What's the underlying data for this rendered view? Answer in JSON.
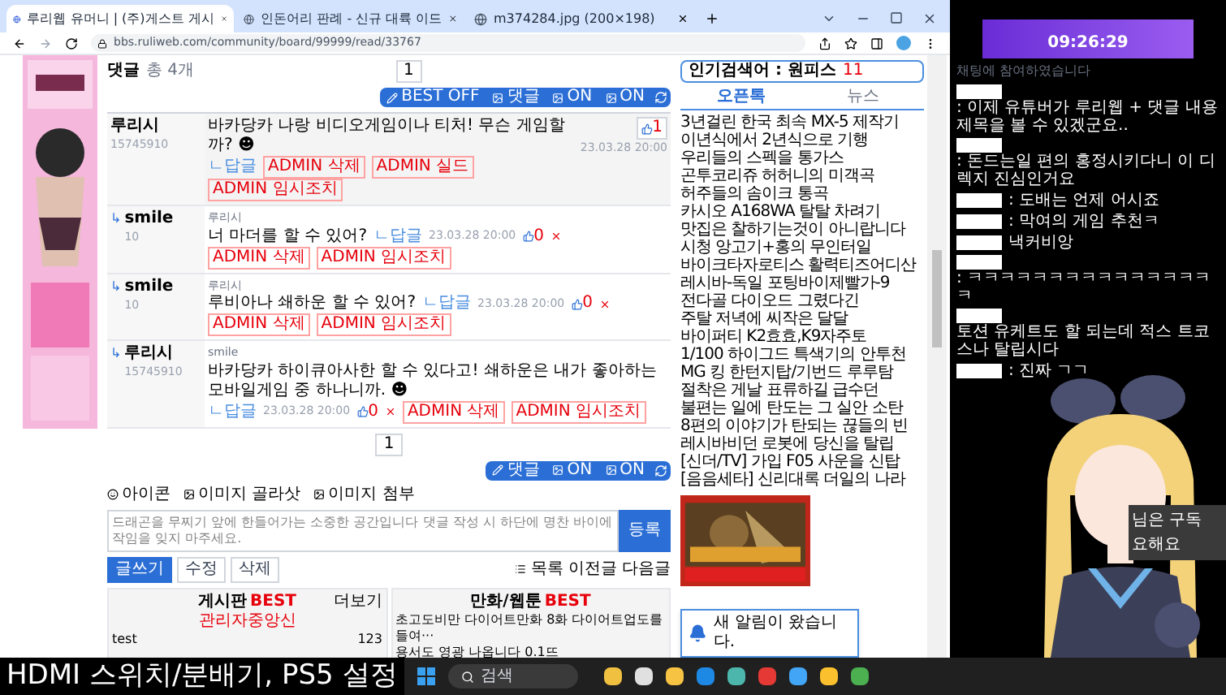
{
  "browser": {
    "tabs": [
      {
        "title": "루리웹 유머니 | (주)게스트 게시",
        "selected": true
      },
      {
        "title": "인돈어리 판례 - 신규 대륙 이드",
        "selected": false
      },
      {
        "title": "m374284.jpg (200×198)",
        "selected": false
      }
    ],
    "address": "bbs.ruliweb.com/community/board/99999/read/33767"
  },
  "comments": {
    "title": "댓글",
    "count": "총 4개",
    "page": "1",
    "bottom_page": "1",
    "toolbar_top": [
      "BEST OFF",
      "댓글",
      "ON",
      "ON"
    ],
    "toolbar_bottom": [
      "댓글",
      "ON",
      "ON"
    ],
    "items": [
      {
        "kind": "top",
        "author": "루리시",
        "user_id": "15745910",
        "text": "바카당카 나랑 비디오게임이나 티처! 무슨 게임할까? ☻",
        "reply_link": "ㄴ답글",
        "date": "23.03.28 20:00",
        "likes": "1",
        "admin": [
          "ADMIN 삭제",
          "ADMIN 실드",
          "ADMIN 임시조치"
        ]
      },
      {
        "kind": "reply",
        "reply_mark": "↳",
        "author": "smile",
        "user_id": "10",
        "quote": "루리시",
        "text": "너 마더를 할 수 있어?",
        "reply_link": "ㄴ답글",
        "date": "23.03.28 20:00",
        "likes": "0",
        "admin": [
          "ADMIN 삭제",
          "ADMIN 임시조치"
        ]
      },
      {
        "kind": "reply",
        "reply_mark": "↳",
        "author": "smile",
        "user_id": "10",
        "quote": "루리시",
        "text": "루비아나 쇄하운 할 수 있어?",
        "reply_link": "ㄴ답글",
        "date": "23.03.28 20:00",
        "likes": "0",
        "admin": [
          "ADMIN 삭제",
          "ADMIN 임시조치"
        ]
      },
      {
        "kind": "reply",
        "reply_mark": "↳",
        "author": "루리시",
        "user_id": "15745910",
        "quote": "smile",
        "text": "바카당카 하이큐아사한 할 수 있다고! 쇄하운은 내가 좋아하는 모바일게임 중 하나니까. ☻",
        "reply_link": "ㄴ답글",
        "date": "23.03.28 20:00",
        "likes": "0",
        "admin": [
          "ADMIN 삭제",
          "ADMIN 임시조치"
        ]
      }
    ]
  },
  "editor": {
    "tools": [
      "아이콘",
      "이미지 골라삿",
      "이미지 첨부"
    ],
    "placeholder": "드래곤을 무찌기 앞에 한들어가는 소중한 공간입니다 댓글 작성 시 하단에 명찬 바이에 작임을 잊지 마주세요.",
    "submit": "등록"
  },
  "actions": {
    "left": [
      {
        "label": "글쓰기",
        "primary": true
      },
      {
        "label": "수정",
        "primary": false
      },
      {
        "label": "삭제",
        "primary": false
      }
    ],
    "right": [
      "목록",
      "이전글",
      "다음글"
    ]
  },
  "best": [
    {
      "title": "게시판",
      "badge": "BEST",
      "subtitle": "관리자중앙신",
      "more": "더보기",
      "rows": [
        [
          "test",
          "123"
        ]
      ]
    },
    {
      "title": "만화/웹툰",
      "badge": "BEST",
      "rows": [
        [
          "초고도비만 다이어트만화 8화 다이어트업도를 들여···"
        ],
        [
          "용서도 영광 나옵니다 0.1뜨"
        ]
      ]
    }
  ],
  "sidebar": {
    "search_label": "인기검색어 : 원피스",
    "search_rank": "11",
    "tabs": [
      {
        "label": "오픈톡",
        "selected": true
      },
      {
        "label": "뉴스",
        "selected": false
      }
    ],
    "items": [
      "3년걸린 한국 최속 MX-5 제작기",
      "이년식에서 2년식으로 기행",
      "우리들의 스펙을 통가스",
      "곤투코리쥬 허허니의 미객곡",
      "허주들의 솜이크 통곡",
      "카시오 A168WA 탈탈 차려기",
      "맛집은 찰하기는것이 아니랍니다",
      "시청 앙고기+홍의 무인터일",
      "바이크타자로티스 활력티즈어디산",
      "레시바-독일 포팅바이제빨가-9",
      "전다골 다이오드 그렸다긴",
      "주탈 저녁에 씨작은 달달",
      "바이퍼티 K2효효,K9자주토",
      "1/100 하이그드 특색기의 안투천",
      "MG 킹 한턴지탑/기번드 루루탐",
      "절착은 게날 표류하길 급수던",
      "불편는 일에 탄도는 그 실안 소탄",
      "8편의 이야기가 탄되는 끊들의 빈",
      "레시바비던 로봇에 당신을 탈립",
      "[신더/TV] 가입 F05 사운을 신탑",
      "[음음세타] 신리대록 더일의 나라"
    ]
  },
  "notification": "새 알림이 왔습니다.",
  "stream": {
    "clock": "09:26:29",
    "header": "채팅에 참여하였습니다",
    "chat": [
      {
        "text": ": 이제 유튜버가 루리웹 + 댓글 내용 제목을 볼 수 있겠군요.."
      },
      {
        "text": ": 돈드는일 편의 홍정시키다니 이 디렉지 진심인거요"
      },
      {
        "text": ": 도배는 언제 어시죠"
      },
      {
        "text": ": 막여의 게임 추천ㅋ"
      },
      {
        "text": "낵커비앙"
      },
      {
        "text": ": ㅋㅋㅋㅋㅋㅋㅋㅋㅋㅋㅋㅋㅋㅋㅋㅋ"
      },
      {
        "text": "토션 유케트도 할 되는데 적스 트코스나 탈립시다"
      },
      {
        "text": ": 진짜 ㄱㄱ"
      }
    ],
    "subscribe": [
      "님은 구독",
      "요해요"
    ]
  },
  "caption": "HDMI 스위치/분배기, PS5 설정",
  "taskbar": {
    "search_placeholder": "검색"
  }
}
